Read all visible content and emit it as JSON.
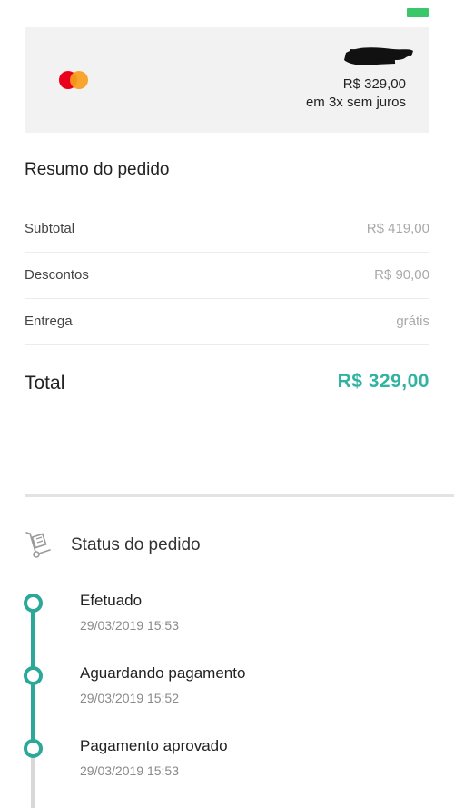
{
  "status_bar": {
    "indicator_color": "#3ac76a"
  },
  "payment": {
    "card_brand_icon": "mastercard-icon",
    "amount": "R$ 329,00",
    "installments": "em 3x sem juros"
  },
  "summary": {
    "title": "Resumo do pedido",
    "rows": [
      {
        "label": "Subtotal",
        "value": "R$ 419,00"
      },
      {
        "label": "Descontos",
        "value": "R$ 90,00"
      },
      {
        "label": "Entrega",
        "value": "grátis"
      }
    ],
    "total_label": "Total",
    "total_value": "R$ 329,00"
  },
  "order_status": {
    "icon": "hand-truck-icon",
    "title": "Status do pedido",
    "steps": [
      {
        "title": "Efetuado",
        "date": "29/03/2019 15:53"
      },
      {
        "title": "Aguardando pagamento",
        "date": "29/03/2019 15:52"
      },
      {
        "title": "Pagamento aprovado",
        "date": "29/03/2019 15:53"
      }
    ]
  },
  "colors": {
    "accent": "#31b3a1",
    "timeline": "#2ba898",
    "timeline_pending": "#d8d8d8"
  }
}
